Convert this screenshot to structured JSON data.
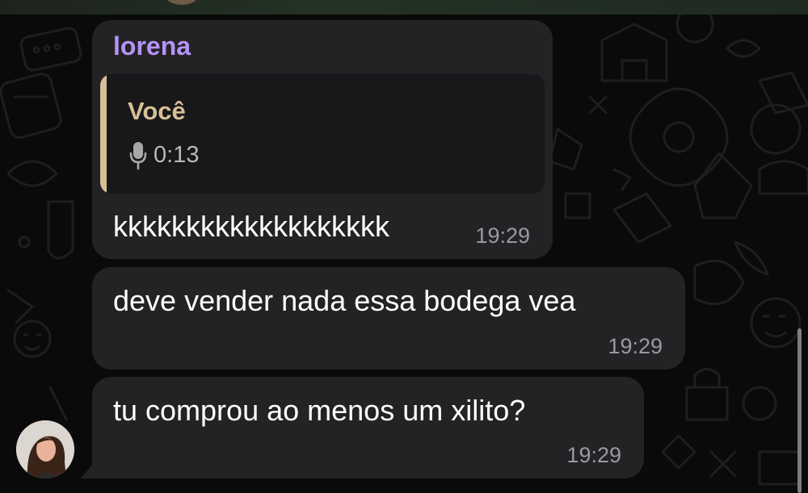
{
  "chat": {
    "messages": [
      {
        "sender": "lorena",
        "quote": {
          "author": "Você",
          "duration": "0:13",
          "icon": "mic-icon"
        },
        "text": "kkkkkkkkkkkkkkkkkkk",
        "time": "19:29"
      },
      {
        "text": "deve vender nada essa bodega vea",
        "time": "19:29"
      },
      {
        "text": "tu comprou ao menos um xilito?",
        "time": "19:29"
      }
    ]
  },
  "colors": {
    "background": "#0a0a0a",
    "bubble": "#232326",
    "sender_name": "#b693f5",
    "quote_accent": "#d7bf97",
    "timestamp": "#9a9a9e"
  }
}
